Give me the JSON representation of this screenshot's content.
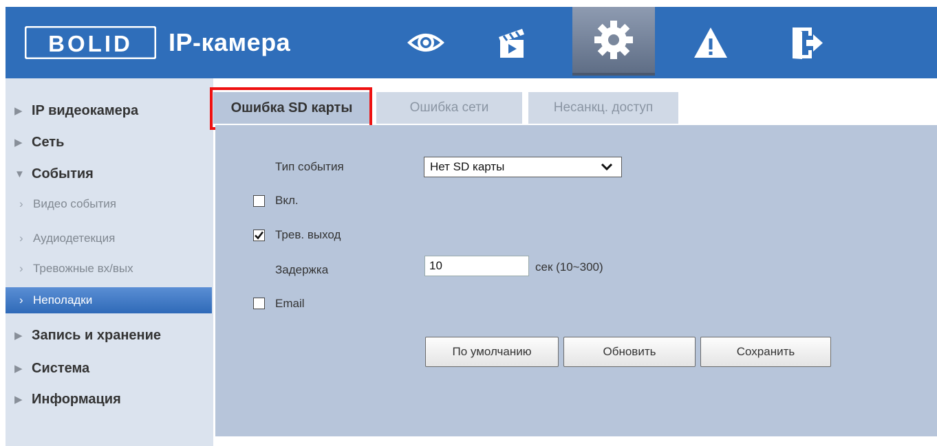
{
  "header": {
    "logo_text": "BOLID",
    "title": "IP-камера",
    "nav": [
      {
        "name": "live-view",
        "icon": "eye-icon"
      },
      {
        "name": "playback",
        "icon": "clapperboard-icon"
      },
      {
        "name": "setup",
        "icon": "gear-icon",
        "active": true
      },
      {
        "name": "alarm",
        "icon": "warning-icon"
      },
      {
        "name": "logout",
        "icon": "exit-door-icon"
      }
    ]
  },
  "sidebar": {
    "items": [
      {
        "label": "IP видеокамера",
        "caret": "▶"
      },
      {
        "label": "Сеть",
        "caret": "▶"
      },
      {
        "label": "События",
        "caret": "▼"
      },
      {
        "label": "Видео события",
        "chev": "›"
      },
      {
        "label": "Аудиодетекция",
        "chev": "›"
      },
      {
        "label": "Тревожные вх/вых",
        "chev": "›"
      },
      {
        "label": "Неполадки",
        "chev": "›",
        "selected": true
      },
      {
        "label": "Запись и хранение",
        "caret": "▶"
      },
      {
        "label": "Система",
        "caret": "▶"
      },
      {
        "label": "Информация",
        "caret": "▶"
      }
    ]
  },
  "tabs": [
    {
      "label": "Ошибка SD карты",
      "active": true
    },
    {
      "label": "Ошибка сети"
    },
    {
      "label": "Несанкц. доступ"
    }
  ],
  "form": {
    "event_type_label": "Тип события",
    "event_type_value": "Нет SD карты",
    "enable_label": "Вкл.",
    "enable_checked": false,
    "alarm_out_label": "Трев. выход",
    "alarm_out_checked": true,
    "delay_label": "Задержка",
    "delay_value": "10",
    "delay_unit": "сек (10~300)",
    "email_label": "Email",
    "email_checked": false
  },
  "buttons": {
    "default": "По умолчанию",
    "refresh": "Обновить",
    "save": "Сохранить"
  },
  "colors": {
    "header": "#2f6eba",
    "sidebar": "#dbe3ee",
    "content": "#b7c5da",
    "highlight": "#ee1111"
  }
}
